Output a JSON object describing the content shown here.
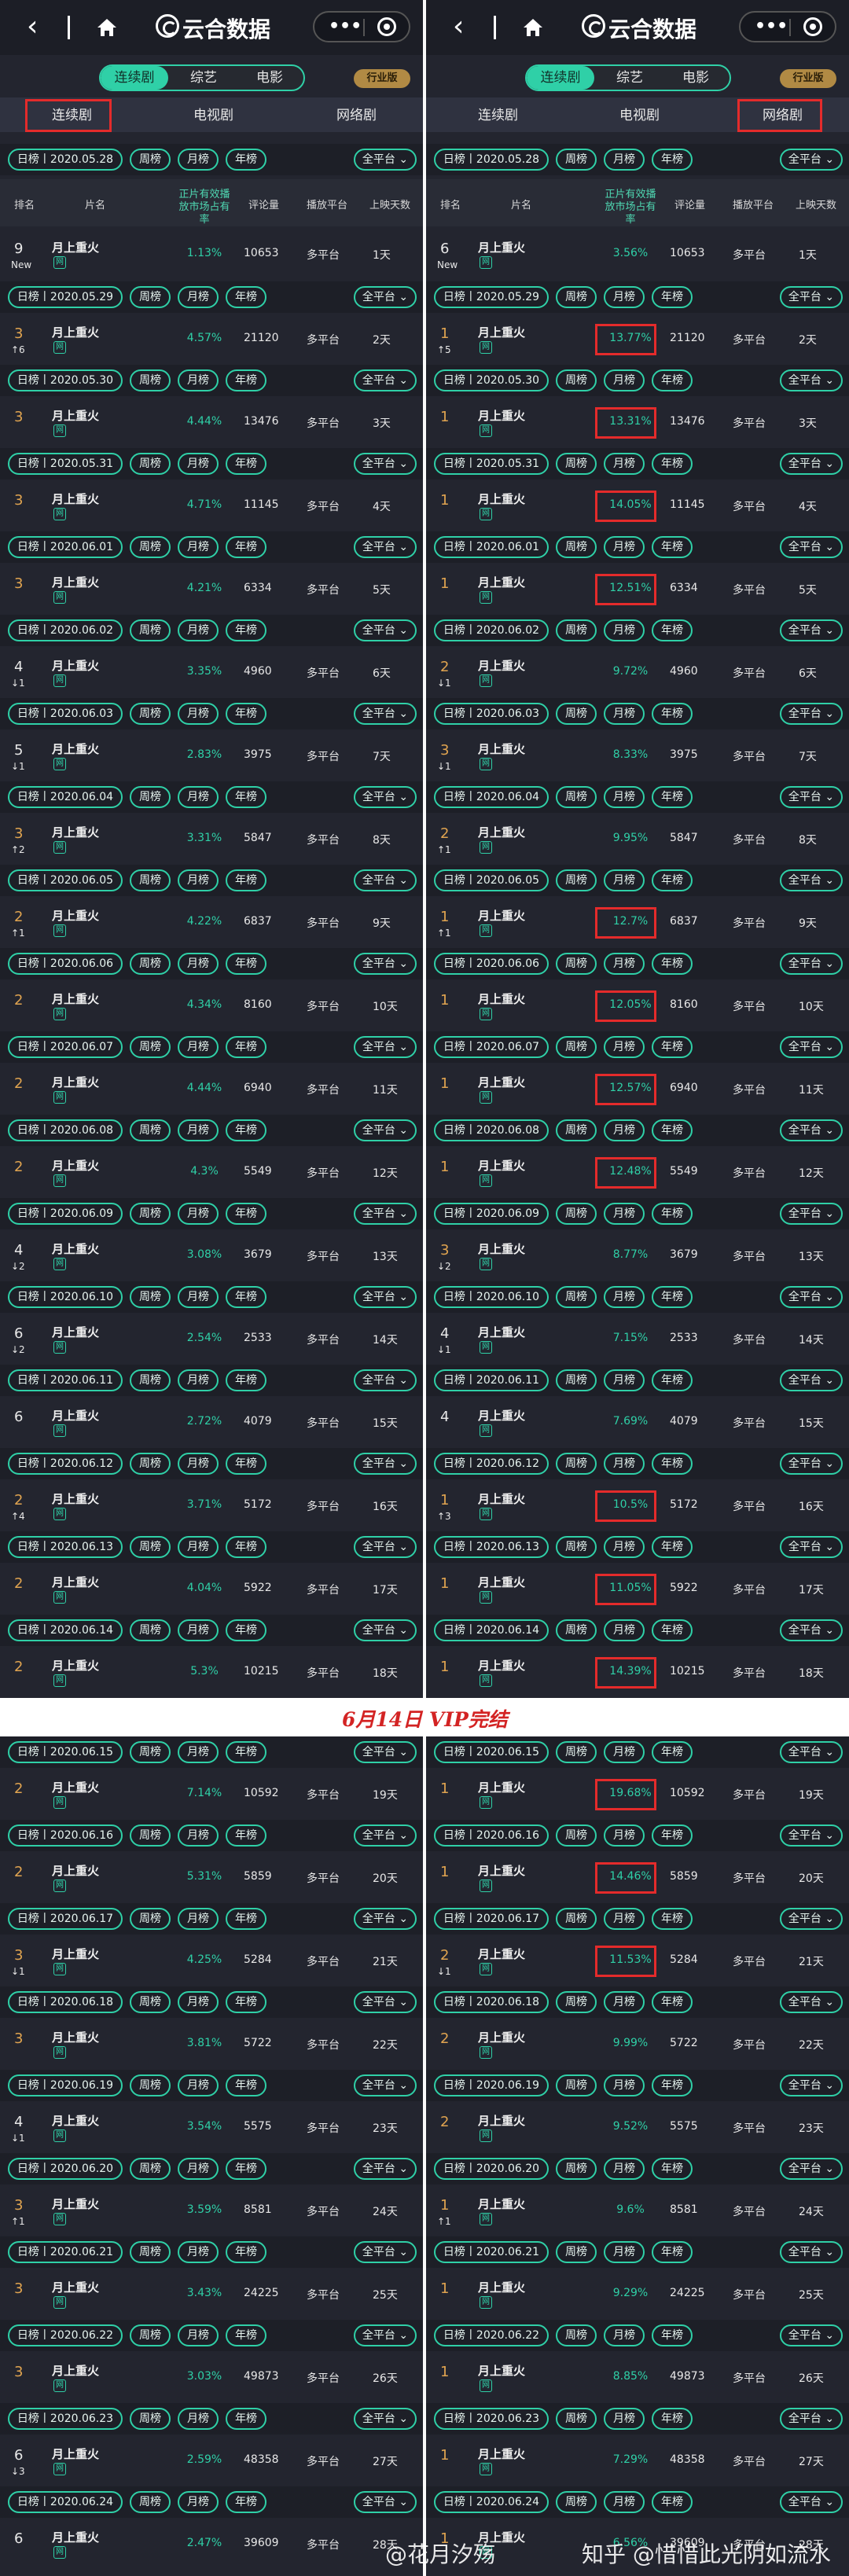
{
  "nav": {
    "title": "云合数据",
    "more": "•••"
  },
  "segments": [
    "连续剧",
    "综艺",
    "电影"
  ],
  "industry_badge": "行业版",
  "subtabs": [
    "连续剧",
    "电视剧",
    "网络剧"
  ],
  "filter_buttons": [
    "周榜",
    "月榜",
    "年榜"
  ],
  "filter_all": "全平台",
  "header": [
    "排名",
    "片名",
    "正片有效播放市场占有率",
    "评论量",
    "播放平台",
    "上映天数"
  ],
  "show": {
    "name": "月上重火",
    "tag": "网",
    "platform": "多平台"
  },
  "banner": "6月14日  VIP完结",
  "watermark": {
    "weibo": "@花月汐殇",
    "zhihu": "知乎 @惜惜此光阴如流水"
  },
  "colors": {
    "accent": "#2fd0a7",
    "highlight": "#e42b2b",
    "gold": "#e0a450"
  },
  "days": [
    {
      "date": "日榜丨2020.05.28",
      "l": {
        "rank": "9",
        "chg": "New",
        "share": "1.13%"
      },
      "r": {
        "rank": "6",
        "chg": "New",
        "share": "3.56%"
      },
      "comments": "10653",
      "day": "1天"
    },
    {
      "date": "日榜丨2020.05.29",
      "l": {
        "rank": "3",
        "chg": "↑6",
        "share": "4.57%"
      },
      "r": {
        "rank": "1",
        "chg": "↑5",
        "share": "13.77%"
      },
      "comments": "21120",
      "day": "2天"
    },
    {
      "date": "日榜丨2020.05.30",
      "l": {
        "rank": "3",
        "chg": "",
        "share": "4.44%"
      },
      "r": {
        "rank": "1",
        "chg": "",
        "share": "13.31%"
      },
      "comments": "13476",
      "day": "3天"
    },
    {
      "date": "日榜丨2020.05.31",
      "l": {
        "rank": "3",
        "chg": "",
        "share": "4.71%"
      },
      "r": {
        "rank": "1",
        "chg": "",
        "share": "14.05%"
      },
      "comments": "11145",
      "day": "4天"
    },
    {
      "date": "日榜丨2020.06.01",
      "l": {
        "rank": "3",
        "chg": "",
        "share": "4.21%"
      },
      "r": {
        "rank": "1",
        "chg": "",
        "share": "12.51%"
      },
      "comments": "6334",
      "day": "5天"
    },
    {
      "date": "日榜丨2020.06.02",
      "l": {
        "rank": "4",
        "chg": "↓1",
        "share": "3.35%"
      },
      "r": {
        "rank": "2",
        "chg": "↓1",
        "share": "9.72%"
      },
      "comments": "4960",
      "day": "6天"
    },
    {
      "date": "日榜丨2020.06.03",
      "l": {
        "rank": "5",
        "chg": "↓1",
        "share": "2.83%"
      },
      "r": {
        "rank": "3",
        "chg": "↓1",
        "share": "8.33%"
      },
      "comments": "3975",
      "day": "7天"
    },
    {
      "date": "日榜丨2020.06.04",
      "l": {
        "rank": "3",
        "chg": "↑2",
        "share": "3.31%"
      },
      "r": {
        "rank": "2",
        "chg": "↑1",
        "share": "9.95%"
      },
      "comments": "5847",
      "day": "8天"
    },
    {
      "date": "日榜丨2020.06.05",
      "l": {
        "rank": "2",
        "chg": "↑1",
        "share": "4.22%"
      },
      "r": {
        "rank": "1",
        "chg": "↑1",
        "share": "12.7%"
      },
      "comments": "6837",
      "day": "9天"
    },
    {
      "date": "日榜丨2020.06.06",
      "l": {
        "rank": "2",
        "chg": "",
        "share": "4.34%"
      },
      "r": {
        "rank": "1",
        "chg": "",
        "share": "12.05%"
      },
      "comments": "8160",
      "day": "10天"
    },
    {
      "date": "日榜丨2020.06.07",
      "l": {
        "rank": "2",
        "chg": "",
        "share": "4.44%"
      },
      "r": {
        "rank": "1",
        "chg": "",
        "share": "12.57%"
      },
      "comments": "6940",
      "day": "11天"
    },
    {
      "date": "日榜丨2020.06.08",
      "l": {
        "rank": "2",
        "chg": "",
        "share": "4.3%"
      },
      "r": {
        "rank": "1",
        "chg": "",
        "share": "12.48%"
      },
      "comments": "5549",
      "day": "12天"
    },
    {
      "date": "日榜丨2020.06.09",
      "l": {
        "rank": "4",
        "chg": "↓2",
        "share": "3.08%"
      },
      "r": {
        "rank": "3",
        "chg": "↓2",
        "share": "8.77%"
      },
      "comments": "3679",
      "day": "13天"
    },
    {
      "date": "日榜丨2020.06.10",
      "l": {
        "rank": "6",
        "chg": "↓2",
        "share": "2.54%"
      },
      "r": {
        "rank": "4",
        "chg": "↓1",
        "share": "7.15%"
      },
      "comments": "2533",
      "day": "14天"
    },
    {
      "date": "日榜丨2020.06.11",
      "l": {
        "rank": "6",
        "chg": "",
        "share": "2.72%"
      },
      "r": {
        "rank": "4",
        "chg": "",
        "share": "7.69%"
      },
      "comments": "4079",
      "day": "15天"
    },
    {
      "date": "日榜丨2020.06.12",
      "l": {
        "rank": "2",
        "chg": "↑4",
        "share": "3.71%"
      },
      "r": {
        "rank": "1",
        "chg": "↑3",
        "share": "10.5%"
      },
      "comments": "5172",
      "day": "16天"
    },
    {
      "date": "日榜丨2020.06.13",
      "l": {
        "rank": "2",
        "chg": "",
        "share": "4.04%"
      },
      "r": {
        "rank": "1",
        "chg": "",
        "share": "11.05%"
      },
      "comments": "5922",
      "day": "17天"
    },
    {
      "date": "日榜丨2020.06.14",
      "l": {
        "rank": "2",
        "chg": "",
        "share": "5.3%"
      },
      "r": {
        "rank": "1",
        "chg": "",
        "share": "14.39%"
      },
      "comments": "10215",
      "day": "18天"
    },
    {
      "date": "日榜丨2020.06.15",
      "l": {
        "rank": "2",
        "chg": "",
        "share": "7.14%"
      },
      "r": {
        "rank": "1",
        "chg": "",
        "share": "19.68%"
      },
      "comments": "10592",
      "day": "19天"
    },
    {
      "date": "日榜丨2020.06.16",
      "l": {
        "rank": "2",
        "chg": "",
        "share": "5.31%"
      },
      "r": {
        "rank": "1",
        "chg": "",
        "share": "14.46%"
      },
      "comments": "5859",
      "day": "20天"
    },
    {
      "date": "日榜丨2020.06.17",
      "l": {
        "rank": "3",
        "chg": "↓1",
        "share": "4.25%"
      },
      "r": {
        "rank": "2",
        "chg": "↓1",
        "share": "11.53%"
      },
      "comments": "5284",
      "day": "21天"
    },
    {
      "date": "日榜丨2020.06.18",
      "l": {
        "rank": "3",
        "chg": "",
        "share": "3.81%"
      },
      "r": {
        "rank": "2",
        "chg": "",
        "share": "9.99%"
      },
      "comments": "5722",
      "day": "22天"
    },
    {
      "date": "日榜丨2020.06.19",
      "l": {
        "rank": "4",
        "chg": "↓1",
        "share": "3.54%"
      },
      "r": {
        "rank": "2",
        "chg": "",
        "share": "9.52%"
      },
      "comments": "5575",
      "day": "23天"
    },
    {
      "date": "日榜丨2020.06.20",
      "l": {
        "rank": "3",
        "chg": "↑1",
        "share": "3.59%"
      },
      "r": {
        "rank": "1",
        "chg": "↑1",
        "share": "9.6%"
      },
      "comments": "8581",
      "day": "24天"
    },
    {
      "date": "日榜丨2020.06.21",
      "l": {
        "rank": "3",
        "chg": "",
        "share": "3.43%"
      },
      "r": {
        "rank": "1",
        "chg": "",
        "share": "9.29%"
      },
      "comments": "24225",
      "day": "25天"
    },
    {
      "date": "日榜丨2020.06.22",
      "l": {
        "rank": "3",
        "chg": "",
        "share": "3.03%"
      },
      "r": {
        "rank": "1",
        "chg": "",
        "share": "8.85%"
      },
      "comments": "49873",
      "day": "26天"
    },
    {
      "date": "日榜丨2020.06.23",
      "l": {
        "rank": "6",
        "chg": "↓3",
        "share": "2.59%"
      },
      "r": {
        "rank": "1",
        "chg": "",
        "share": "7.29%"
      },
      "comments": "48358",
      "day": "27天"
    },
    {
      "date": "日榜丨2020.06.24",
      "l": {
        "rank": "6",
        "chg": "",
        "share": "2.47%"
      },
      "r": {
        "rank": "1",
        "chg": "",
        "share": "6.56%"
      },
      "comments": "39609",
      "day": "28天"
    }
  ],
  "highlighted_right_rows": [
    1,
    2,
    3,
    4,
    8,
    9,
    10,
    11,
    15,
    16,
    17,
    18,
    19,
    20
  ]
}
